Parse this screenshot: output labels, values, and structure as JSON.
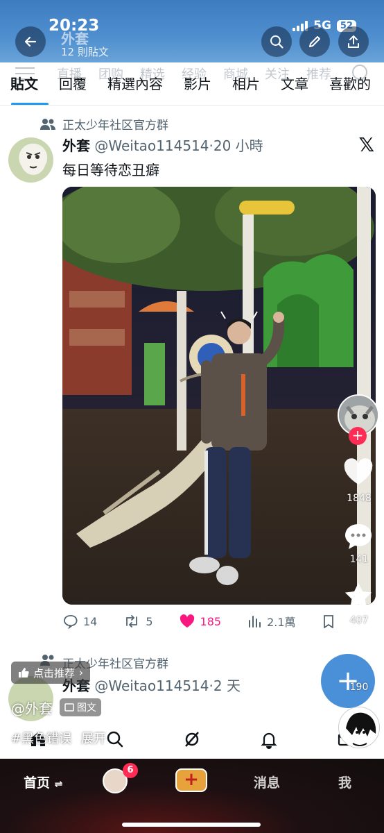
{
  "status_bar": {
    "time": "20:23",
    "network": "5G",
    "battery": "52"
  },
  "header": {
    "title": "外套",
    "subtitle": "12 則貼文"
  },
  "underlying_nav": [
    "直播",
    "团购",
    "精选",
    "经验",
    "商城",
    "关注",
    "推荐"
  ],
  "tabs": [
    {
      "label": "貼文",
      "active": true
    },
    {
      "label": "回覆"
    },
    {
      "label": "精選內容"
    },
    {
      "label": "影片"
    },
    {
      "label": "相片"
    },
    {
      "label": "文章"
    },
    {
      "label": "喜歡的"
    }
  ],
  "post": {
    "community": "正太少年社区官方群",
    "display_name": "外套",
    "handle": "@Weitao114514",
    "sep": "·",
    "time_ago": "20 小時",
    "text": "每日等待恋丑癖",
    "replies": "14",
    "reposts": "5",
    "likes": "185",
    "views": "2.1萬"
  },
  "post2": {
    "community": "正太少年社区官方群",
    "display_name": "外套",
    "handle": "@Weitao114514",
    "sep": "·",
    "time_ago": "2 天"
  },
  "overlay": {
    "likes_count": "1848",
    "comments_count": "141",
    "favorites_count": "407",
    "shares_count": "190",
    "recommend_label": "点击推荐",
    "author_tag": "@外套",
    "type_tag": "图文",
    "hashtag": "#黑色错误",
    "expand_label": "展开"
  },
  "bottom_bar": {
    "home": "首页",
    "home_suffix": "⇌",
    "badge": "6",
    "messages": "消息",
    "me": "我"
  },
  "icons": [
    "back-icon",
    "search-icon",
    "edit-icon",
    "share-icon",
    "community-icon",
    "x-logo-icon",
    "reply-icon",
    "repost-icon",
    "heart-icon",
    "views-icon",
    "bookmark-icon",
    "upload-icon",
    "plus-icon",
    "comment-icon",
    "star-icon",
    "share-arrow-icon",
    "thumb-icon",
    "home-icon",
    "explore-icon",
    "grok-icon",
    "bell-icon",
    "mail-icon"
  ],
  "colors": {
    "accent": "#1d9bf0",
    "like": "#f91880",
    "header_bg": "#3e7cc0",
    "follow": "#fe2c55"
  }
}
